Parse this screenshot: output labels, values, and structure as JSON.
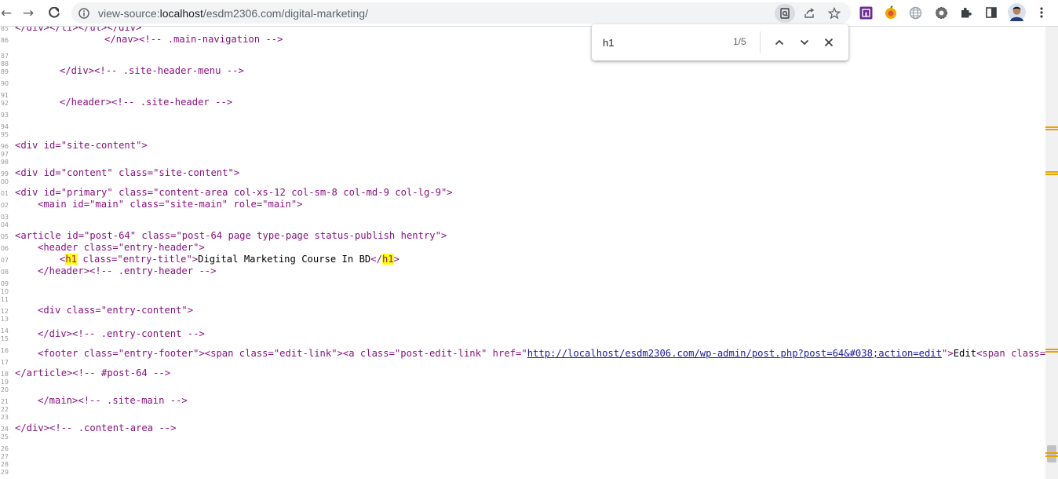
{
  "browser": {
    "url_prefix": "view-source:",
    "url_host": "localhost",
    "url_path": "/esdm2306.com/digital-marketing/",
    "icons": [
      "back-icon",
      "forward-icon",
      "reload-icon",
      "site-info-icon",
      "find-in-page-icon",
      "share-icon",
      "bookmark-star-icon",
      "extension-icon",
      "profile-avatar"
    ]
  },
  "find_bar": {
    "query": "h1",
    "count": "1/5",
    "icons": [
      "chevron-up-icon",
      "chevron-down-icon",
      "close-icon"
    ]
  },
  "line_numbers": [
    "85",
    "86",
    "87",
    "88",
    "89",
    "90",
    "91",
    "92",
    "93",
    "94",
    "95",
    "96",
    "97",
    "98",
    "99",
    "00",
    "01",
    "02",
    "03",
    "04",
    "05",
    "06",
    "07",
    "08",
    "09",
    "10",
    "11",
    "12",
    "13",
    "14",
    "15",
    "16",
    "17",
    "18",
    "19",
    "20",
    "21",
    "22",
    "23",
    "24",
    "25",
    "26",
    "27",
    "28",
    "29"
  ],
  "code": {
    "l85": "</div></li></ul></div>",
    "l86": "</nav><!-- .main-navigation -->",
    "l89": "</div><!-- .site-header-menu -->",
    "l92": "</header><!-- .site-header -->",
    "l95": "<div id=\"site-content\">",
    "l99": "<div id=\"content\" class=\"site-content\">",
    "l101": "<div id=\"primary\" class=\"content-area col-xs-12 col-sm-8 col-md-9 col-lg-9\">",
    "l102": "<main id=\"main\" class=\"site-main\" role=\"main\">",
    "l105": "<article id=\"post-64\" class=\"post-64 page type-page status-publish hentry\">",
    "l106": "<header class=\"entry-header\">",
    "l107": {
      "open_lt": "<",
      "h1_open": "h1",
      "open_rest": " class=\"entry-title\">",
      "text": "Digital Marketing Course In BD",
      "close_lt": "</",
      "h1_close": "h1",
      "close_gt": ">"
    },
    "l108": "</header><!-- .entry-header -->",
    "l112": "<div class=\"entry-content\">",
    "l114": "</div><!-- .entry-content -->",
    "l116": {
      "before_link": "<footer class=\"entry-footer\"><span class=\"edit-link\"><a class=\"post-edit-link\" href=\"",
      "link": "http://localhost/esdm2306.com/wp-admin/post.php?post=64&#038;action=edit",
      "after_link": "\">",
      "text": "Edit",
      "tail": "<span class=\"scre"
    },
    "l118": "</article><!-- #post-64 -->",
    "l121": "</main><!-- .site-main -->",
    "l124": "</div><!-- .content-area -->"
  },
  "colors": {
    "tag": "#881280",
    "attr_name": "#994500",
    "attr_value": "#1a1aa6",
    "comment": "#236e25",
    "highlight": "#ffff00",
    "scroll_marker": "#e8a400"
  }
}
